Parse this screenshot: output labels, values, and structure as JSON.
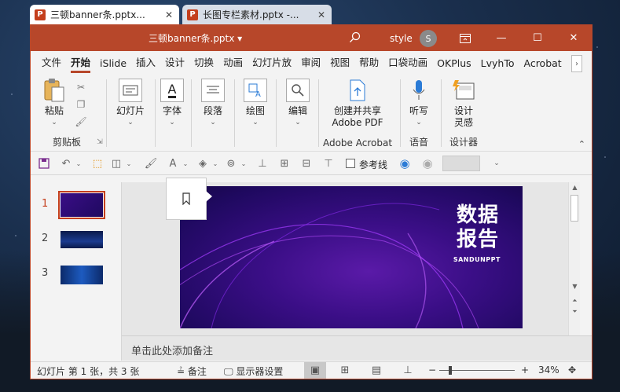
{
  "tabs": [
    {
      "title": "三顿banner条.pptx...",
      "icon": "powerpoint-icon",
      "active": true
    },
    {
      "title": "长图专栏素材.pptx -...",
      "icon": "powerpoint-icon",
      "active": false
    }
  ],
  "titlebar": {
    "doc_title": "三顿banner条.pptx  ▾",
    "user_name": "style",
    "avatar_initial": "S"
  },
  "ribbon_tabs": [
    "文件",
    "开始",
    "iSlide",
    "插入",
    "设计",
    "切换",
    "动画",
    "幻灯片放",
    "审阅",
    "视图",
    "帮助",
    "口袋动画",
    "OKPlus",
    "LvyhTo",
    "Acrobat"
  ],
  "ribbon_scroll_label": "›",
  "ribbon": {
    "paste": "粘贴",
    "clipboard": "剪贴板",
    "slides": "幻灯片",
    "font": "字体",
    "paragraph": "段落",
    "drawing": "绘图",
    "editing": "编辑",
    "share_line1": "创建并共享",
    "share_line2": "Adobe PDF",
    "acrobat": "Adobe Acrobat",
    "dictate": "听写",
    "voice": "语音",
    "designer_line1": "设计",
    "designer_line2": "灵感",
    "designer": "设计器"
  },
  "qat": {
    "guides_label": "参考线"
  },
  "slides": [
    {
      "number": "1",
      "selected": true
    },
    {
      "number": "2",
      "selected": false
    },
    {
      "number": "3",
      "selected": false
    }
  ],
  "slide": {
    "title_line1": "数据",
    "title_line2": "报告",
    "subtitle": "SANDUNPPT"
  },
  "notes_placeholder": "单击此处添加备注",
  "statusbar": {
    "slide_info": "幻灯片 第 1 张，共 3 张",
    "notes": "备注",
    "display_settings": "显示器设置",
    "zoom": "34%",
    "zoom_minus": "−",
    "zoom_plus": "+"
  },
  "colors": {
    "accent": "#b7472a",
    "slide_bg": "#3a0e86"
  }
}
